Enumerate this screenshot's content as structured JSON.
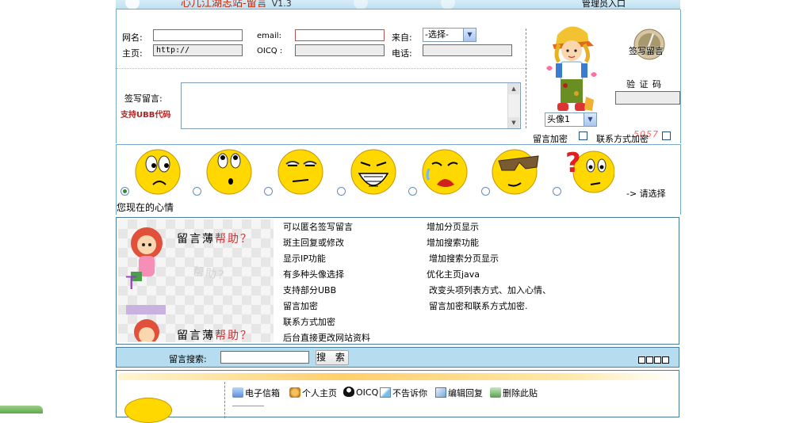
{
  "header": {
    "site_title": "心儿江湖志站-留言",
    "version": "V1.3",
    "admin_link": "管理员入口"
  },
  "form": {
    "name_label": "网名:",
    "email_label": "email:",
    "from_label": "来自:",
    "from_select": "-选择-",
    "homepage_label": "主页:",
    "homepage_value": "http://",
    "oicq_label": "OICQ :",
    "phone_label": "电话:",
    "message_label": "签写留言:",
    "ubb_note": "支持UBB代码",
    "captcha_label": "验 证 码",
    "captcha_code": "5057",
    "avatar_select": "头像1",
    "sign_button": "签写留言",
    "encrypt_message_label": "留言加密",
    "encrypt_contact_label": "联系方式加密"
  },
  "moods": {
    "selected_index": 0,
    "count": 7,
    "choose_hint": "-> 请选择",
    "current_mood_label": "您现在的心情"
  },
  "help": {
    "title_black": "留言薄",
    "title_red": "帮助？",
    "features_left": [
      "可以匿名签写留言",
      "斑主回复或修改",
      "显示IP功能",
      "有多种头像选择",
      "支持部分UBB",
      "留言加密",
      "联系方式加密",
      "后台直接更改网站资料"
    ],
    "features_right": [
      "增加分页显示",
      "增加搜索功能",
      "增加搜索分页显示",
      "优化主页java",
      "改变头项列表方式、加入心情、",
      "留言加密和联系方式加密."
    ]
  },
  "search": {
    "label": "留言搜索:",
    "button": "搜 索"
  },
  "entry_toolbar": {
    "email": "电子信箱",
    "homepage": "个人主页",
    "oicq": "OICQ",
    "secret": "不告诉你",
    "edit_reply": "编辑回复",
    "delete": "删除此贴"
  },
  "colors": {
    "accent_blue": "#7aa9c9",
    "search_bar": "#b6dcef",
    "title_red": "#cc2200",
    "ubb_red": "#b22222"
  }
}
